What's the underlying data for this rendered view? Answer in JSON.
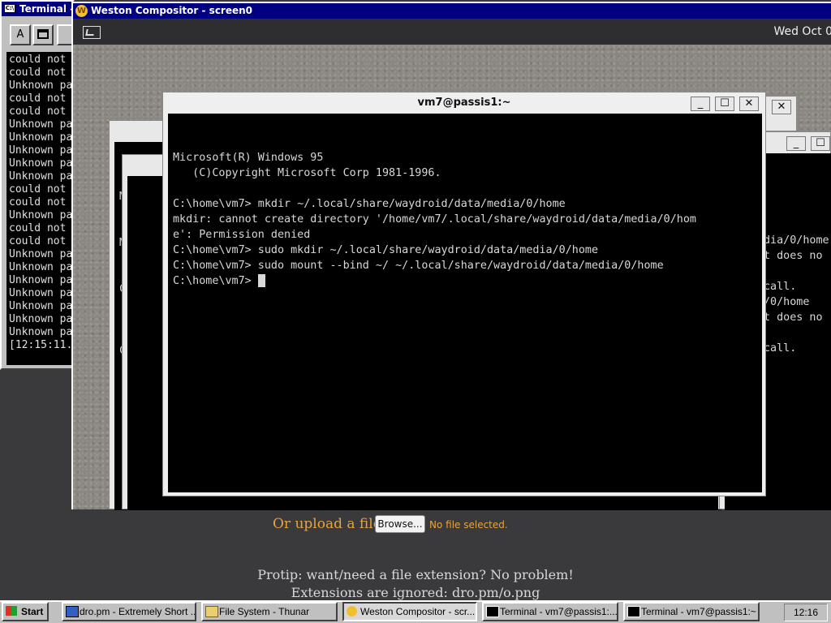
{
  "left_terminal": {
    "title": "Terminal - v",
    "lines": [
      "could not",
      "could not",
      "Unknown pa",
      "could not",
      "could not",
      "Unknown pa",
      "Unknown pa",
      "Unknown pa",
      "Unknown pa",
      "Unknown pa",
      "could not",
      "could not",
      "Unknown pa",
      "could not",
      "could not",
      "Unknown pa",
      "Unknown pa",
      "Unknown pa",
      "Unknown pa",
      "Unknown pa",
      "Unknown pa",
      "Unknown pa",
      "[12:15:11."
    ]
  },
  "weston": {
    "title": "Weston Compositor - screen0",
    "clock": "Wed Oct 0"
  },
  "bg_windows": {
    "back_left_lines": [
      "M",
      "",
      "",
      "Micro",
      "  (C",
      "",
      "C:\\hom",
      "[",
      "[",
      "[",
      "C"
    ],
    "mid_left_lines": [
      "C:\\ho"
    ],
    "right_lines": [
      "",
      "",
      "",
      "",
      "dia/0/home",
      "t does no",
      "",
      "call.",
      "/0/home",
      "t does no",
      "",
      "call."
    ]
  },
  "main_terminal": {
    "title": "vm7@passis1:~",
    "lines": [
      "",
      "",
      "Microsoft(R) Windows 95",
      "   (C)Copyright Microsoft Corp 1981-1996.",
      "",
      "C:\\home\\vm7> mkdir ~/.local/share/waydroid/data/media/0/home",
      "mkdir: cannot create directory '/home/vm7/.local/share/waydroid/data/media/0/hom",
      "e': Permission denied",
      "C:\\home\\vm7> sudo mkdir ~/.local/share/waydroid/data/media/0/home",
      "C:\\home\\vm7> sudo mount --bind ~/ ~/.local/share/waydroid/data/media/0/home",
      "C:\\home\\vm7> "
    ]
  },
  "page": {
    "upload_label": "Or upload a file:",
    "browse_label": "Browse...",
    "no_file": "No file selected.",
    "protip": "Protip: want/need a file extension? No problem!",
    "ext_note": "Extensions are ignored: dro.pm/o.png"
  },
  "taskbar": {
    "start_label": "Start",
    "clock": "12:16",
    "items": [
      {
        "label": "dro.pm - Extremely Short ..."
      },
      {
        "label": "File System - Thunar"
      },
      {
        "label": "Weston Compositor - scr..."
      },
      {
        "label": "Terminal - vm7@passis1:..."
      },
      {
        "label": "Terminal - vm7@passis1:~"
      }
    ]
  },
  "colors": {
    "win95_title": "#000080",
    "accent_orange": "#e8a33c",
    "terminal_bg": "#000000"
  }
}
